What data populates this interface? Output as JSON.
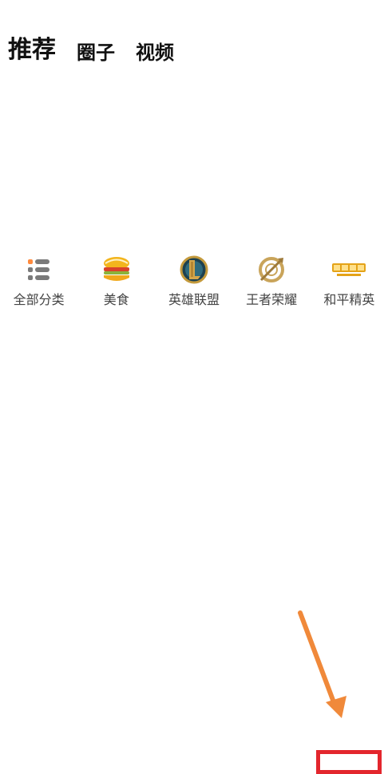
{
  "tabs": [
    {
      "label": "推荐",
      "active": true
    },
    {
      "label": "圈子",
      "active": false
    },
    {
      "label": "视频",
      "active": false
    }
  ],
  "categories": [
    {
      "label": "全部分类",
      "icon": "list-icon"
    },
    {
      "label": "美食",
      "icon": "food-icon"
    },
    {
      "label": "英雄联盟",
      "icon": "lol-icon"
    },
    {
      "label": "王者荣耀",
      "icon": "honor-of-kings-icon"
    },
    {
      "label": "和平精英",
      "icon": "peacekeeper-elite-icon"
    }
  ],
  "colors": {
    "accent": "#e4a318",
    "annotation_arrow": "#f0893a",
    "annotation_box": "#e3262d",
    "label_gray": "#444444",
    "icon_gray": "#7a7a7a"
  }
}
